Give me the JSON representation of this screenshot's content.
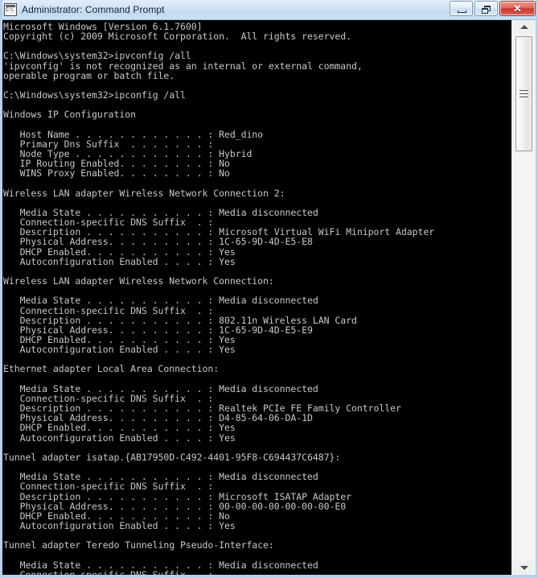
{
  "window": {
    "title": "Administrator: Command Prompt",
    "icon": "command-prompt-icon",
    "buttons": {
      "minimize": "–",
      "restore": "❐",
      "close": "✕"
    },
    "colors": {
      "console_background": "#000000",
      "console_text": "#c8c8c8",
      "titlebar": "#cfe0f3",
      "close_button": "#c8372c",
      "frame": "#b5d2ec"
    }
  },
  "scrollbar": {
    "up_arrow": "scroll-up-arrow",
    "down_arrow": "scroll-down-arrow",
    "thumb": "scroll-thumb"
  },
  "console": {
    "lines": [
      "Microsoft Windows [Version 6.1.7600]",
      "Copyright (c) 2009 Microsoft Corporation.  All rights reserved.",
      "",
      "C:\\Windows\\system32>ipvconfig /all",
      "'ipvconfig' is not recognized as an internal or external command,",
      "operable program or batch file.",
      "",
      "C:\\Windows\\system32>ipconfig /all",
      "",
      "Windows IP Configuration",
      "",
      "   Host Name . . . . . . . . . . . . : Red_dino",
      "   Primary Dns Suffix  . . . . . . . :",
      "   Node Type . . . . . . . . . . . . : Hybrid",
      "   IP Routing Enabled. . . . . . . . : No",
      "   WINS Proxy Enabled. . . . . . . . : No",
      "",
      "Wireless LAN adapter Wireless Network Connection 2:",
      "",
      "   Media State . . . . . . . . . . . : Media disconnected",
      "   Connection-specific DNS Suffix  . :",
      "   Description . . . . . . . . . . . : Microsoft Virtual WiFi Miniport Adapter",
      "   Physical Address. . . . . . . . . : 1C-65-9D-4D-E5-E8",
      "   DHCP Enabled. . . . . . . . . . . : Yes",
      "   Autoconfiguration Enabled . . . . : Yes",
      "",
      "Wireless LAN adapter Wireless Network Connection:",
      "",
      "   Media State . . . . . . . . . . . : Media disconnected",
      "   Connection-specific DNS Suffix  . :",
      "   Description . . . . . . . . . . . : 802.11n Wireless LAN Card",
      "   Physical Address. . . . . . . . . : 1C-65-9D-4D-E5-E9",
      "   DHCP Enabled. . . . . . . . . . . : Yes",
      "   Autoconfiguration Enabled . . . . : Yes",
      "",
      "Ethernet adapter Local Area Connection:",
      "",
      "   Media State . . . . . . . . . . . : Media disconnected",
      "   Connection-specific DNS Suffix  . :",
      "   Description . . . . . . . . . . . : Realtek PCIe FE Family Controller",
      "   Physical Address. . . . . . . . . : D4-85-64-06-DA-1D",
      "   DHCP Enabled. . . . . . . . . . . : Yes",
      "   Autoconfiguration Enabled . . . . : Yes",
      "",
      "Tunnel adapter isatap.{AB17950D-C492-4401-95F8-C694437C6487}:",
      "",
      "   Media State . . . . . . . . . . . : Media disconnected",
      "   Connection-specific DNS Suffix  . :",
      "   Description . . . . . . . . . . . : Microsoft ISATAP Adapter",
      "   Physical Address. . . . . . . . . : 00-00-00-00-00-00-00-E0",
      "   DHCP Enabled. . . . . . . . . . . : No",
      "   Autoconfiguration Enabled . . . . : Yes",
      "",
      "Tunnel adapter Teredo Tunneling Pseudo-Interface:",
      "",
      "   Media State . . . . . . . . . . . : Media disconnected",
      "   Connection-specific DNS Suffix  . :"
    ]
  }
}
